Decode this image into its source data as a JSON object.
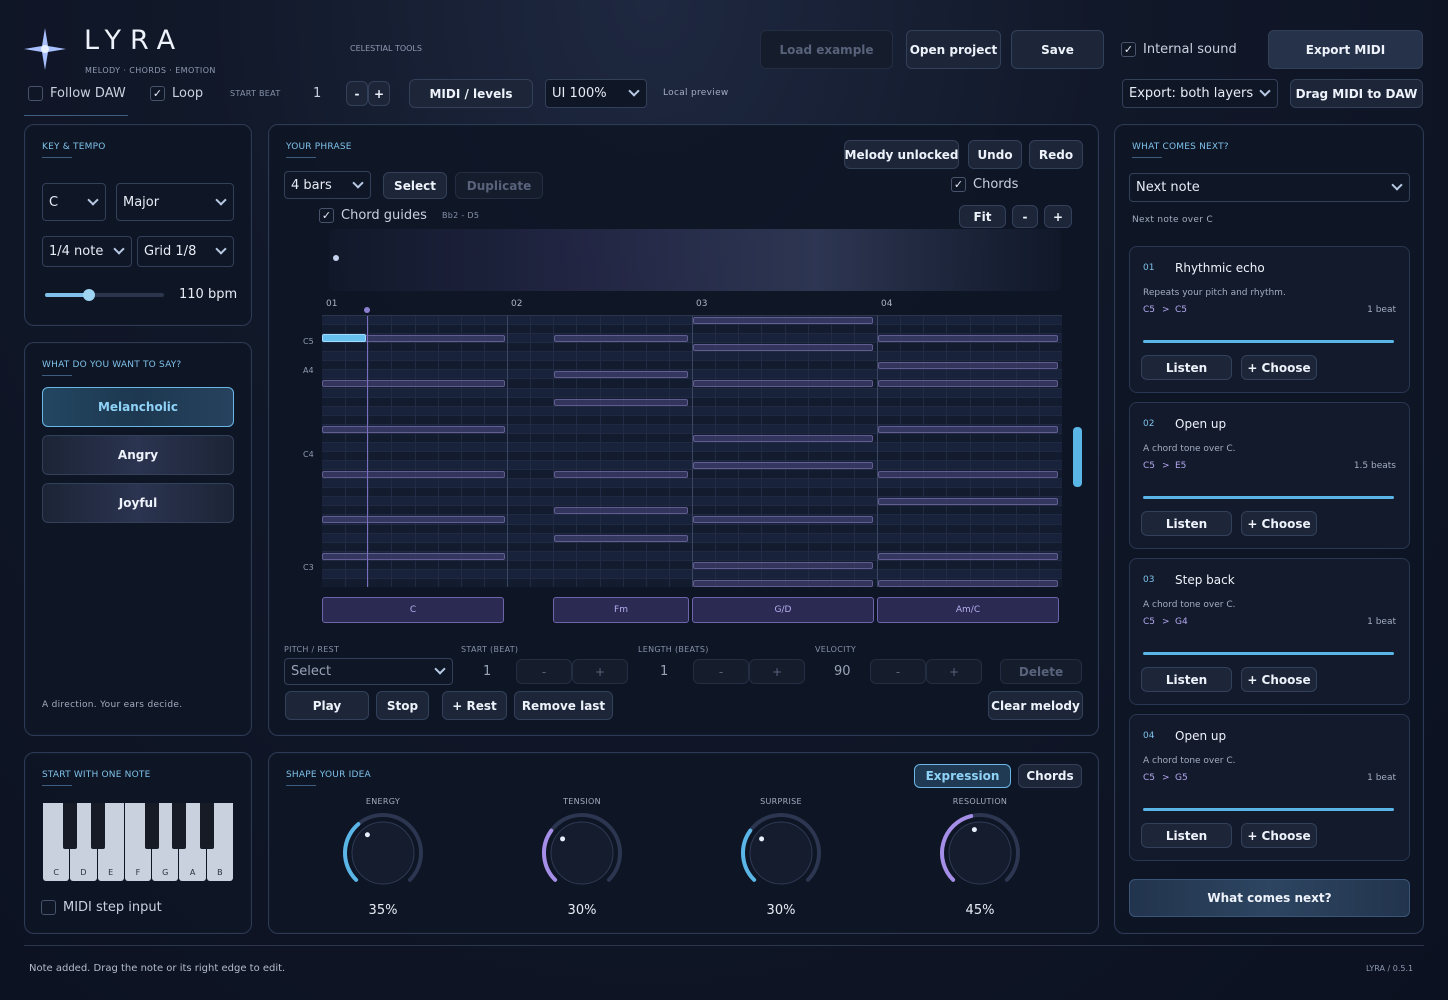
{
  "app": {
    "name": "LYRA",
    "tagline": "MELODY · CHORDS · EMOTION",
    "subtitle": "CELESTIAL TOOLS"
  },
  "topbar": {
    "load_example": "Load example",
    "open_project": "Open project",
    "save": "Save",
    "internal_sound": "Internal sound",
    "export_midi": "Export MIDI",
    "follow_daw": "Follow DAW",
    "loop": "Loop",
    "start_beat_label": "START BEAT",
    "start_beat": "1",
    "minus": "-",
    "plus": "+",
    "midi_levels": "MIDI / levels",
    "ui_zoom": "UI 100%",
    "local_preview": "Local preview",
    "export_layers": "Export: both layers",
    "drag_midi": "Drag MIDI to DAW"
  },
  "key_tempo": {
    "title": "KEY & TEMPO",
    "key": "C",
    "mode": "Major",
    "note_value": "1/4 note",
    "grid": "Grid 1/8",
    "bpm": "110 bpm",
    "tempo_fraction": 0.37
  },
  "say": {
    "title": "WHAT DO YOU WANT TO SAY?",
    "options": [
      "Melancholic",
      "Angry",
      "Joyful"
    ],
    "selected": "Melancholic",
    "footer": "A direction. Your ears decide."
  },
  "start_note": {
    "title": "START WITH ONE NOTE",
    "keys": [
      "C",
      "D",
      "E",
      "F",
      "G",
      "A",
      "B"
    ],
    "midi_step": "MIDI step input"
  },
  "phrase": {
    "title": "YOUR PHRASE",
    "melody_unlocked": "Melody unlocked",
    "undo": "Undo",
    "redo": "Redo",
    "bars": "4 bars",
    "select": "Select",
    "duplicate": "Duplicate",
    "chords": "Chords",
    "chord_guides": "Chord guides",
    "range": "Bb2 - D5",
    "fit": "Fit",
    "zoom_minus": "-",
    "zoom_plus": "+",
    "bar_labels": [
      "01",
      "02",
      "03",
      "04"
    ],
    "pitch_labels": [
      "C5",
      "A4",
      "C4",
      "C3"
    ],
    "chord_names": [
      "C",
      "Fm",
      "G/D",
      "Am/C"
    ],
    "pitch_rest_label": "PITCH / REST",
    "pitch_placeholder": "Select",
    "start_label": "START (BEAT)",
    "start_value": "1",
    "length_label": "LENGTH (BEATS)",
    "length_value": "1",
    "velocity_label": "VELOCITY",
    "velocity_value": "90",
    "minus": "-",
    "plus": "+",
    "delete": "Delete",
    "play": "Play",
    "stop": "Stop",
    "rest": "+ Rest",
    "remove_last": "Remove last",
    "clear_melody": "Clear melody"
  },
  "shape": {
    "title": "SHAPE YOUR IDEA",
    "tab_expression": "Expression",
    "tab_chords": "Chords",
    "knobs": [
      {
        "label": "ENERGY",
        "value": "35%",
        "v": 0.35,
        "color": "#5bb6e8"
      },
      {
        "label": "TENSION",
        "value": "30%",
        "v": 0.3,
        "color": "#a58ee8"
      },
      {
        "label": "SURPRISE",
        "value": "30%",
        "v": 0.3,
        "color": "#5bb6e8"
      },
      {
        "label": "RESOLUTION",
        "value": "45%",
        "v": 0.45,
        "color": "#a58ee8"
      }
    ]
  },
  "next": {
    "title": "WHAT COMES NEXT?",
    "mode": "Next note",
    "context": "Next note over C",
    "cards": [
      {
        "num": "01",
        "title": "Rhythmic echo",
        "desc": "Repeats your pitch and rhythm.",
        "from": "C5",
        "arrow": ">",
        "to": "C5",
        "dur": "1 beat",
        "listen": "Listen",
        "choose": "+ Choose"
      },
      {
        "num": "02",
        "title": "Open up",
        "desc": "A chord tone over C.",
        "from": "C5",
        "arrow": ">",
        "to": "E5",
        "dur": "1.5 beats",
        "listen": "Listen",
        "choose": "+ Choose"
      },
      {
        "num": "03",
        "title": "Step back",
        "desc": "A chord tone over C.",
        "from": "C5",
        "arrow": ">",
        "to": "G4",
        "dur": "1 beat",
        "listen": "Listen",
        "choose": "+ Choose"
      },
      {
        "num": "04",
        "title": "Open up",
        "desc": "A chord tone over C.",
        "from": "C5",
        "arrow": ">",
        "to": "G5",
        "dur": "1 beat",
        "listen": "Listen",
        "choose": "+ Choose"
      }
    ],
    "button": "What comes next?"
  },
  "status": {
    "message": "Note added. Drag the note or its right edge to edit.",
    "version": "LYRA / 0.5.1"
  },
  "colors": {
    "accent": "#7fc1ea",
    "violet": "#8a7fd0",
    "panel": "#0e1525"
  }
}
